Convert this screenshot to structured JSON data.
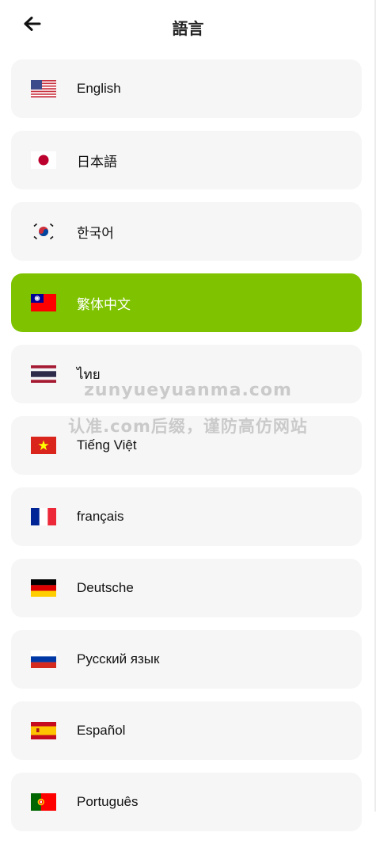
{
  "header": {
    "title": "語言",
    "back_icon": "arrow-left-icon"
  },
  "languages": [
    {
      "label": "English",
      "flag": "us-flag-icon",
      "selected": false
    },
    {
      "label": "日本語",
      "flag": "jp-flag-icon",
      "selected": false
    },
    {
      "label": "한국어",
      "flag": "kr-flag-icon",
      "selected": false
    },
    {
      "label": "繁体中文",
      "flag": "tw-flag-icon",
      "selected": true
    },
    {
      "label": "ไทย",
      "flag": "th-flag-icon",
      "selected": false
    },
    {
      "label": "Tiếng Việt",
      "flag": "vn-flag-icon",
      "selected": false
    },
    {
      "label": "français",
      "flag": "fr-flag-icon",
      "selected": false
    },
    {
      "label": "Deutsche",
      "flag": "de-flag-icon",
      "selected": false
    },
    {
      "label": "Русский язык",
      "flag": "ru-flag-icon",
      "selected": false
    },
    {
      "label": "Español",
      "flag": "es-flag-icon",
      "selected": false
    },
    {
      "label": "Português",
      "flag": "pt-flag-icon",
      "selected": false
    }
  ],
  "colors": {
    "accent": "#7fc300",
    "item_bg": "#f6f6f6"
  },
  "watermark": {
    "line1": "zunyueyuanma.com",
    "line2": "认准.com后缀，谨防高仿网站"
  }
}
